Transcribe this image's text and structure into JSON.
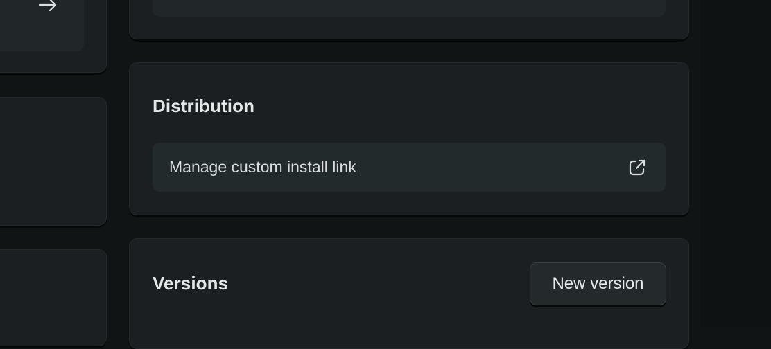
{
  "distribution": {
    "title": "Distribution",
    "install_link_label": "Manage custom install link",
    "install_link_icon": "external-link-icon"
  },
  "versions": {
    "title": "Versions",
    "new_version_label": "New version"
  },
  "left_column": {
    "card_action_icon": "arrow-right-icon"
  },
  "colors": {
    "background": "#111415",
    "card": "#1b1f21",
    "row": "#232a2c",
    "text": "#e6e8e9"
  }
}
